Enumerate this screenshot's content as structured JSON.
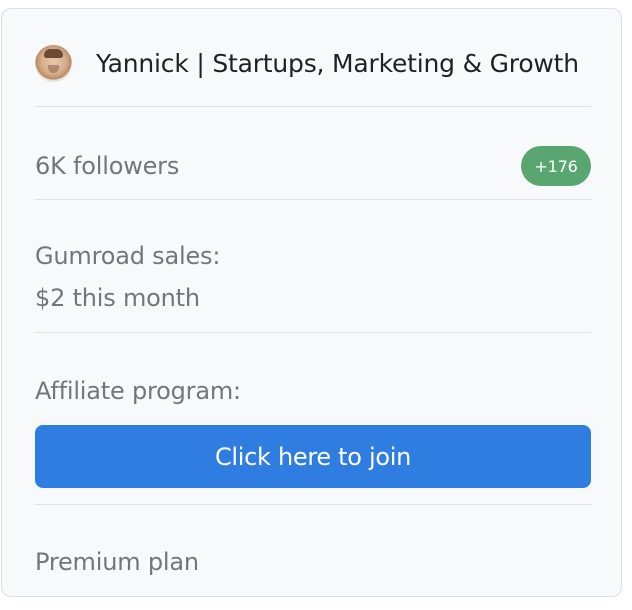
{
  "profile": {
    "name": "Yannick | Startups, Marketing & Growth",
    "avatar_alt": "avatar"
  },
  "stats": {
    "followers_label": "6K followers",
    "followers_delta": "+176"
  },
  "sales": {
    "label": "Gumroad sales:",
    "value": "$2 this month"
  },
  "affiliate": {
    "label": "Affiliate program:",
    "button_label": "Click here to join"
  },
  "plan": {
    "label": "Premium plan"
  },
  "colors": {
    "card_background": "#f8f9fb",
    "card_border": "#dcdee3",
    "badge_green": "#5aa671",
    "button_blue": "#2f7de1",
    "muted_text": "#74767b",
    "primary_text": "#1f2124"
  }
}
